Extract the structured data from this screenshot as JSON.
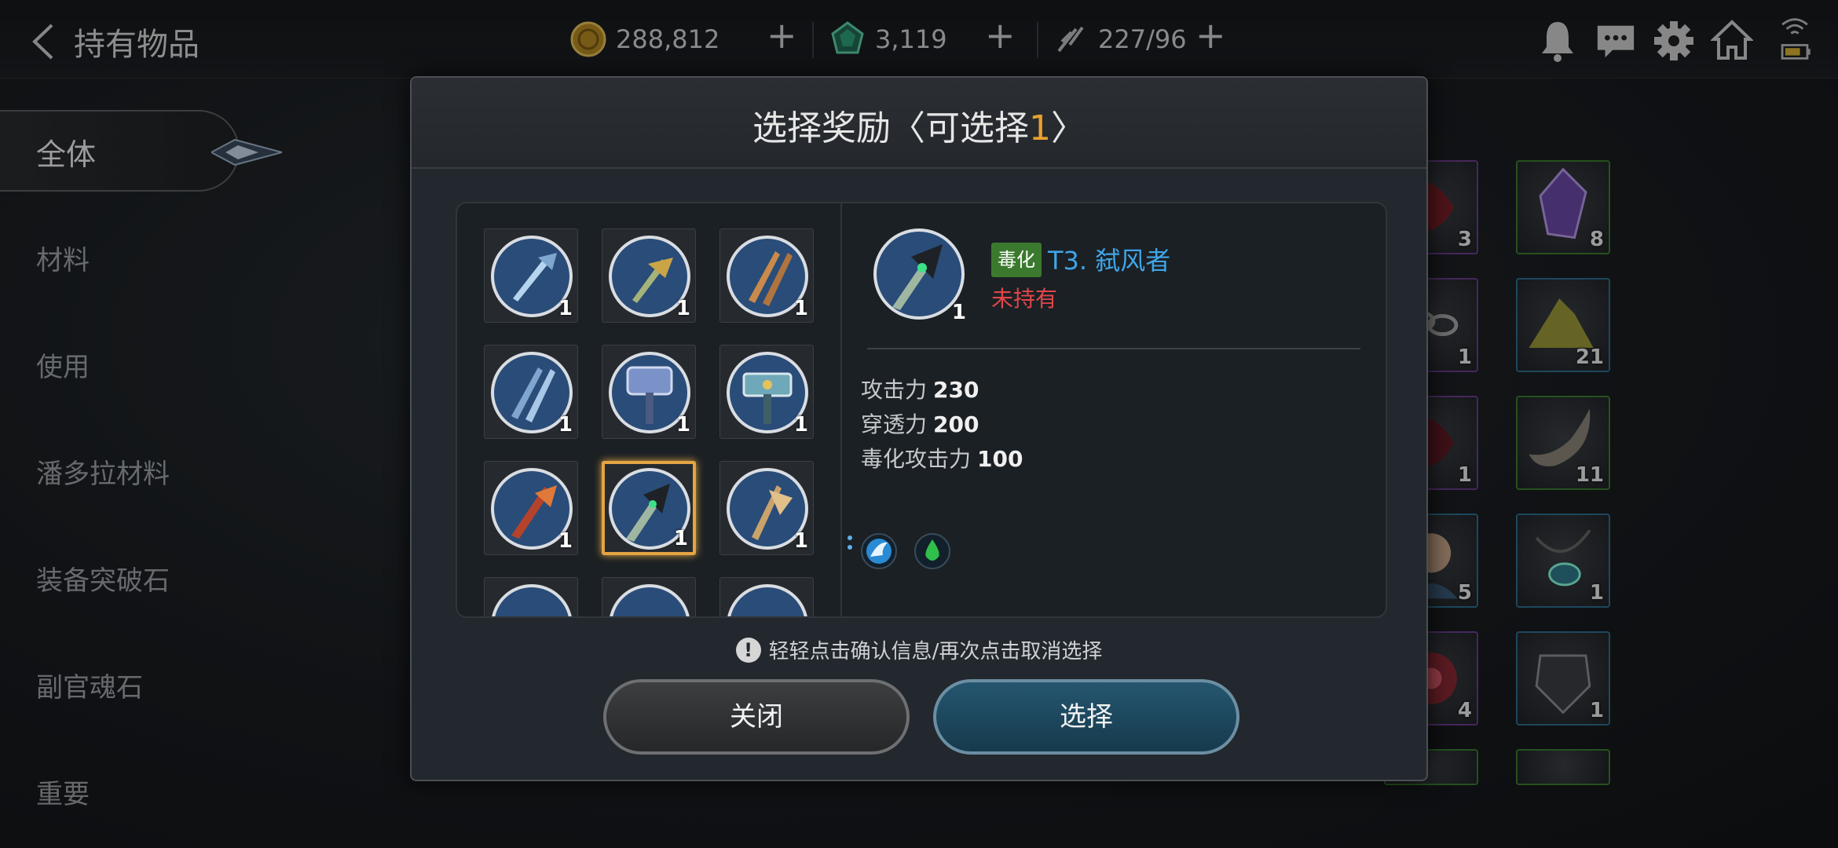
{
  "header": {
    "title": "持有物品",
    "currencies": [
      {
        "name": "gold",
        "value": "288,812"
      },
      {
        "name": "crystal",
        "value": "3,119"
      },
      {
        "name": "stamina",
        "value": "227/96"
      }
    ]
  },
  "sidebar": {
    "items": [
      {
        "label": "全体",
        "active": true
      },
      {
        "label": "材料"
      },
      {
        "label": "使用"
      },
      {
        "label": "潘多拉材料"
      },
      {
        "label": "装备突破石"
      },
      {
        "label": "副官魂石"
      },
      {
        "label": "重要"
      }
    ]
  },
  "inventory": {
    "items": [
      {
        "count": "3",
        "icon": "red-creature-icon"
      },
      {
        "count": "8",
        "icon": "purple-crystal-icon"
      },
      {
        "count": "1",
        "icon": "chain-icon"
      },
      {
        "count": "21",
        "icon": "ore-pile-icon"
      },
      {
        "count": "1",
        "icon": "red-creature-icon"
      },
      {
        "count": "11",
        "icon": "horn-icon"
      },
      {
        "count": "5",
        "icon": "portrait-icon"
      },
      {
        "count": "1",
        "icon": "amulet-icon"
      },
      {
        "count": "4",
        "icon": "red-orb-icon"
      },
      {
        "count": "1",
        "icon": "armor-icon"
      }
    ]
  },
  "modal": {
    "title_prefix": "选择奖励〈可选择",
    "title_count": "1",
    "title_suffix": "〉",
    "rewards": [
      {
        "qty": "1",
        "icon": "ice-sword-icon"
      },
      {
        "qty": "1",
        "icon": "gold-sword-icon"
      },
      {
        "qty": "1",
        "icon": "twin-daggers-icon"
      },
      {
        "qty": "1",
        "icon": "blue-daggers-icon"
      },
      {
        "qty": "1",
        "icon": "blue-hammer-icon"
      },
      {
        "qty": "1",
        "icon": "teal-hammer-icon"
      },
      {
        "qty": "1",
        "icon": "flame-sword-icon"
      },
      {
        "qty": "1",
        "icon": "dark-sword-icon",
        "selected": true
      },
      {
        "qty": "1",
        "icon": "gold-axe-icon"
      },
      {
        "qty": "",
        "icon": "partial-icon"
      },
      {
        "qty": "",
        "icon": "partial-icon"
      },
      {
        "qty": "",
        "icon": "partial-icon"
      }
    ],
    "detail": {
      "qty": "1",
      "tag": "毒化",
      "name": "T3. 弑风者",
      "status": "未持有",
      "stats": [
        {
          "label": "攻击力",
          "value": "230"
        },
        {
          "label": "穿透力",
          "value": "200"
        },
        {
          "label": "毒化攻击力",
          "value": "100"
        }
      ],
      "skills": [
        "wing-skill-icon",
        "poison-drop-icon"
      ]
    },
    "hint": "轻轻点击确认信息/再次点击取消选择",
    "close_label": "关闭",
    "select_label": "选择"
  },
  "colors": {
    "accent_gold": "#e9a12e",
    "selected_border": "#e3a443",
    "name_blue": "#3fa5e8",
    "status_red": "#e2464a",
    "tag_green": "#3b7a2e"
  }
}
